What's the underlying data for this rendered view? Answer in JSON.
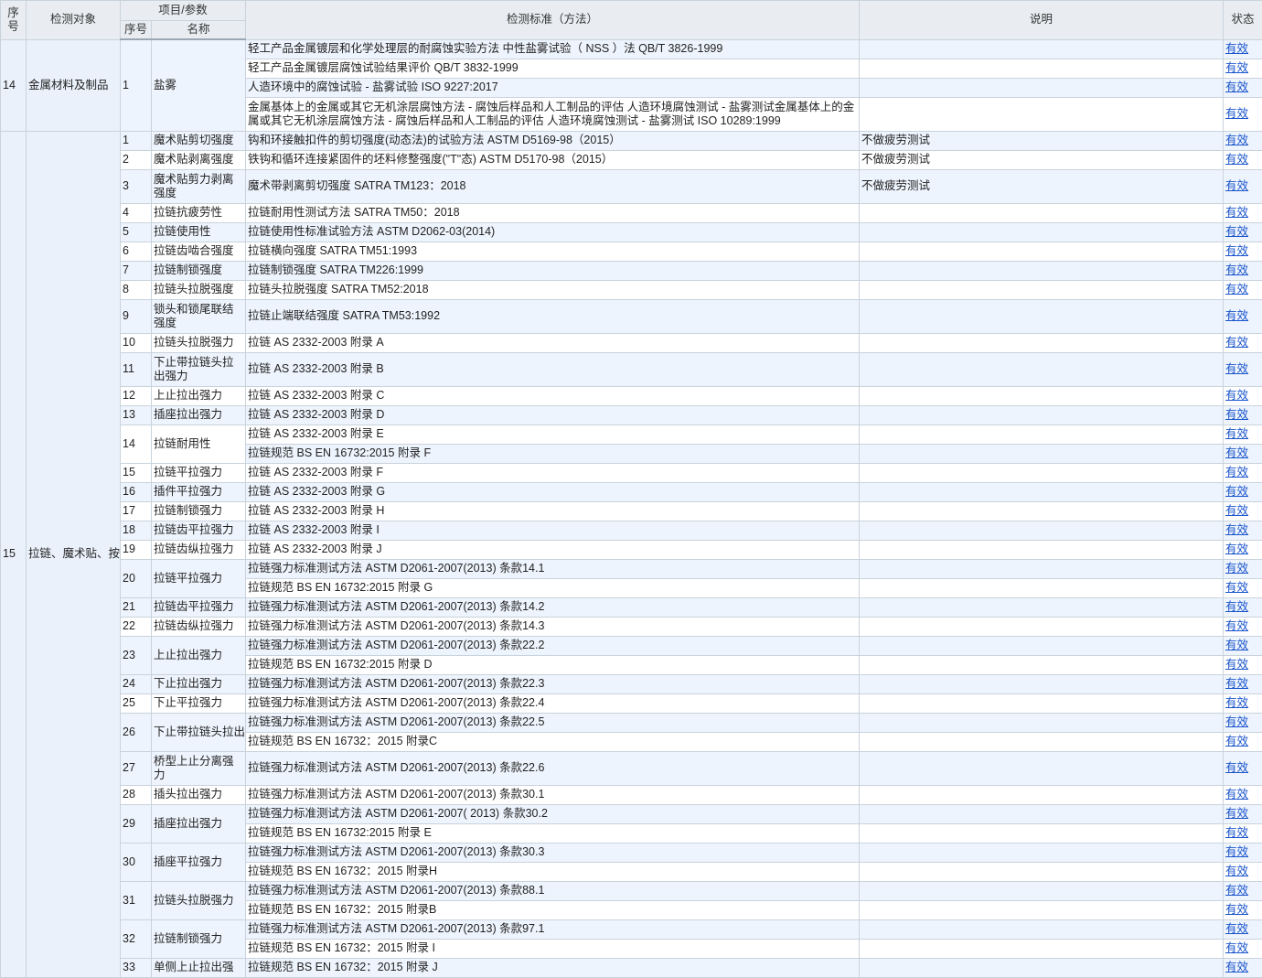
{
  "headers": {
    "seq": "序号",
    "object": "检测对象",
    "item_param": "项目/参数",
    "item_seq": "序号",
    "item_name": "名称",
    "standard": "检测标准（方法）",
    "note": "说明",
    "status": "状态"
  },
  "status_label": "有效",
  "groups": [
    {
      "seq": "14",
      "object": "金属材料及制品",
      "items": [
        {
          "num": "1",
          "name": "盐雾",
          "rows": [
            {
              "std": "轻工产品金属镀层和化学处理层的耐腐蚀实验方法 中性盐雾试验（ NSS ）法 QB/T 3826-1999",
              "note": ""
            },
            {
              "std": "轻工产品金属镀层腐蚀试验结果评价 QB/T 3832-1999",
              "note": ""
            },
            {
              "std": "人造环境中的腐蚀试验 - 盐雾试验 ISO 9227:2017",
              "note": ""
            },
            {
              "std": "金属基体上的金属或其它无机涂层腐蚀方法 - 腐蚀后样品和人工制品的评估 人造环境腐蚀测试 - 盐雾测试金属基体上的金属或其它无机涂层腐蚀方法 - 腐蚀后样品和人工制品的评估 人造环境腐蚀测试 - 盐雾测试 ISO 10289:1999",
              "note": "",
              "tall": true
            }
          ]
        }
      ]
    },
    {
      "seq": "15",
      "object": "拉链、魔术贴、按扣",
      "items": [
        {
          "num": "1",
          "name": "魔术贴剪切强度",
          "rows": [
            {
              "std": "钩和环接触扣件的剪切强度(动态法)的试验方法 ASTM D5169-98（2015）",
              "note": "不做疲劳测试"
            }
          ]
        },
        {
          "num": "2",
          "name": "魔术贴剥离强度",
          "rows": [
            {
              "std": "铁钩和循环连接紧固件的坯料修整强度(\"T\"态) ASTM D5170-98（2015）",
              "note": "不做疲劳测试"
            }
          ]
        },
        {
          "num": "3",
          "name": "魔术贴剪力剥离强度",
          "tall": true,
          "rows": [
            {
              "std": "魔术带剥离剪切强度 SATRA TM123：2018",
              "note": "不做疲劳测试",
              "tall": true
            }
          ]
        },
        {
          "num": "4",
          "name": "拉链抗疲劳性",
          "rows": [
            {
              "std": "拉链耐用性测试方法 SATRA TM50：2018",
              "note": ""
            }
          ]
        },
        {
          "num": "5",
          "name": "拉链使用性",
          "rows": [
            {
              "std": "拉链使用性标准试验方法 ASTM D2062-03(2014)",
              "note": ""
            }
          ]
        },
        {
          "num": "6",
          "name": "拉链齿啮合强度",
          "rows": [
            {
              "std": "拉链横向强度 SATRA TM51:1993",
              "note": ""
            }
          ]
        },
        {
          "num": "7",
          "name": "拉链制锁强度",
          "rows": [
            {
              "std": "拉链制锁强度 SATRA TM226:1999",
              "note": ""
            }
          ]
        },
        {
          "num": "8",
          "name": "拉链头拉脱强度",
          "rows": [
            {
              "std": "拉链头拉脱强度 SATRA TM52:2018",
              "note": ""
            }
          ]
        },
        {
          "num": "9",
          "name": "锁头和锁尾联结强度",
          "tall": true,
          "rows": [
            {
              "std": "拉链止端联结强度 SATRA TM53:1992",
              "note": "",
              "tall": true
            }
          ]
        },
        {
          "num": "10",
          "name": "拉链头拉脱强力",
          "rows": [
            {
              "std": "拉链 AS 2332-2003 附录 A",
              "note": ""
            }
          ]
        },
        {
          "num": "11",
          "name": "下止带拉链头拉出强力",
          "tall": true,
          "rows": [
            {
              "std": "拉链 AS 2332-2003 附录 B",
              "note": "",
              "tall": true
            }
          ]
        },
        {
          "num": "12",
          "name": "上止拉出强力",
          "rows": [
            {
              "std": "拉链 AS 2332-2003 附录 C",
              "note": ""
            }
          ]
        },
        {
          "num": "13",
          "name": "插座拉出强力",
          "rows": [
            {
              "std": "拉链 AS 2332-2003 附录 D",
              "note": ""
            }
          ]
        },
        {
          "num": "14",
          "name": "拉链耐用性",
          "rows": [
            {
              "std": "拉链 AS 2332-2003 附录 E",
              "note": ""
            },
            {
              "std": "拉链规范 BS EN 16732:2015 附录 F",
              "note": ""
            }
          ]
        },
        {
          "num": "15",
          "name": "拉链平拉强力",
          "rows": [
            {
              "std": "拉链 AS 2332-2003 附录 F",
              "note": ""
            }
          ]
        },
        {
          "num": "16",
          "name": "插件平拉强力",
          "rows": [
            {
              "std": "拉链 AS 2332-2003 附录 G",
              "note": ""
            }
          ]
        },
        {
          "num": "17",
          "name": "拉链制锁强力",
          "rows": [
            {
              "std": "拉链 AS 2332-2003 附录 H",
              "note": ""
            }
          ]
        },
        {
          "num": "18",
          "name": "拉链齿平拉强力",
          "rows": [
            {
              "std": "拉链 AS 2332-2003 附录 I",
              "note": ""
            }
          ]
        },
        {
          "num": "19",
          "name": "拉链齿纵拉强力",
          "rows": [
            {
              "std": "拉链 AS 2332-2003 附录 J",
              "note": ""
            }
          ]
        },
        {
          "num": "20",
          "name": "拉链平拉强力",
          "rows": [
            {
              "std": "拉链强力标准测试方法 ASTM D2061-2007(2013) 条款14.1",
              "note": ""
            },
            {
              "std": "拉链规范 BS EN 16732:2015 附录 G",
              "note": ""
            }
          ]
        },
        {
          "num": "21",
          "name": "拉链齿平拉强力",
          "rows": [
            {
              "std": "拉链强力标准测试方法 ASTM D2061-2007(2013) 条款14.2",
              "note": ""
            }
          ]
        },
        {
          "num": "22",
          "name": "拉链齿纵拉强力",
          "rows": [
            {
              "std": "拉链强力标准测试方法 ASTM D2061-2007(2013) 条款14.3",
              "note": ""
            }
          ]
        },
        {
          "num": "23",
          "name": "上止拉出强力",
          "rows": [
            {
              "std": "拉链强力标准测试方法 ASTM D2061-2007(2013) 条款22.2",
              "note": ""
            },
            {
              "std": "拉链规范 BS EN 16732:2015 附录 D",
              "note": ""
            }
          ]
        },
        {
          "num": "24",
          "name": "下止拉出强力",
          "rows": [
            {
              "std": "拉链强力标准测试方法 ASTM D2061-2007(2013) 条款22.3",
              "note": ""
            }
          ]
        },
        {
          "num": "25",
          "name": "下止平拉强力",
          "rows": [
            {
              "std": "拉链强力标准测试方法 ASTM D2061-2007(2013) 条款22.4",
              "note": ""
            }
          ]
        },
        {
          "num": "26",
          "name": "下止带拉链头拉出强力",
          "rows": [
            {
              "std": "拉链强力标准测试方法 ASTM D2061-2007(2013) 条款22.5",
              "note": ""
            },
            {
              "std": "拉链规范 BS EN 16732：2015 附录C",
              "note": ""
            }
          ]
        },
        {
          "num": "27",
          "name": "桥型上止分离强力",
          "tall": true,
          "rows": [
            {
              "std": "拉链强力标准测试方法 ASTM D2061-2007(2013) 条款22.6",
              "note": "",
              "tall": true
            }
          ]
        },
        {
          "num": "28",
          "name": "插头拉出强力",
          "rows": [
            {
              "std": "拉链强力标准测试方法 ASTM D2061-2007(2013) 条款30.1",
              "note": ""
            }
          ]
        },
        {
          "num": "29",
          "name": "插座拉出强力",
          "rows": [
            {
              "std": "拉链强力标准测试方法 ASTM D2061-2007( 2013) 条款30.2",
              "note": ""
            },
            {
              "std": "拉链规范 BS EN 16732:2015 附录 E",
              "note": ""
            }
          ]
        },
        {
          "num": "30",
          "name": "插座平拉强力",
          "rows": [
            {
              "std": "拉链强力标准测试方法 ASTM D2061-2007(2013) 条款30.3",
              "note": ""
            },
            {
              "std": "拉链规范 BS EN 16732：2015 附录H",
              "note": ""
            }
          ]
        },
        {
          "num": "31",
          "name": "拉链头拉脱强力",
          "rows": [
            {
              "std": "拉链强力标准测试方法 ASTM D2061-2007(2013) 条款88.1",
              "note": ""
            },
            {
              "std": "拉链规范 BS EN 16732：2015 附录B",
              "note": ""
            }
          ]
        },
        {
          "num": "32",
          "name": "拉链制锁强力",
          "rows": [
            {
              "std": "拉链强力标准测试方法 ASTM D2061-2007(2013) 条款97.1",
              "note": ""
            },
            {
              "std": "拉链规范 BS EN 16732：2015 附录 I",
              "note": ""
            }
          ]
        },
        {
          "num": "33",
          "name": "单侧上止拉出强",
          "rows": [
            {
              "std": "拉链规范 BS EN 16732：2015 附录 J",
              "note": ""
            }
          ]
        }
      ]
    }
  ]
}
